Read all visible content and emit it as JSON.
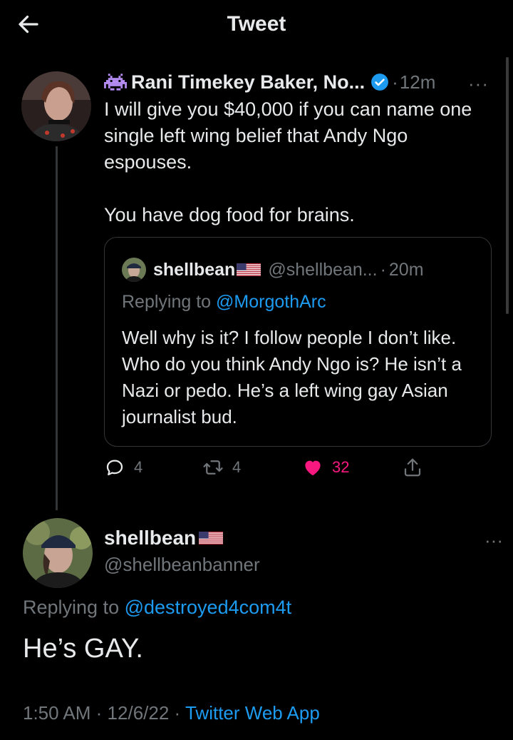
{
  "header": {
    "title": "Tweet"
  },
  "thread": {
    "tweet": {
      "author_name": "Rani Timekey Baker, No...",
      "time": "12m",
      "separator": "·",
      "more": "···",
      "text": "I will give you $40,000 if you can name one single left wing belief that Andy Ngo espouses.\n\nYou have dog food for brains."
    },
    "quote": {
      "author_name": "shellbean",
      "handle": "@shellbean...",
      "time": "20m",
      "separator": "·",
      "replying_prefix": "Replying to",
      "replying_to": "@MorgothArc",
      "text": "Well why is it? I follow people I don’t like. Who do you think Andy Ngo is? He isn’t a Nazi or pedo. He’s a left wing gay Asian journalist bud."
    },
    "actions": {
      "replies": "4",
      "retweets": "4",
      "likes": "32"
    }
  },
  "reply": {
    "author_name": "shellbean",
    "handle": "@shellbeanbanner",
    "more": "···",
    "replying_prefix": "Replying to",
    "replying_to": "@destroyed4com4t",
    "text": "He’s GAY.",
    "time": "1:50 AM",
    "date": "12/6/22",
    "separator": "·",
    "source": "Twitter Web App"
  },
  "colors": {
    "background": "#000000",
    "text": "#e7e9ea",
    "secondary": "#71767b",
    "link": "#1d9bf0",
    "like": "#f91880",
    "verified": "#1d9bf0"
  },
  "icons": [
    "back-arrow-icon",
    "alien-emoji-icon",
    "verified-badge-icon",
    "us-flag-icon",
    "reply-icon",
    "retweet-icon",
    "like-heart-icon",
    "share-icon"
  ]
}
